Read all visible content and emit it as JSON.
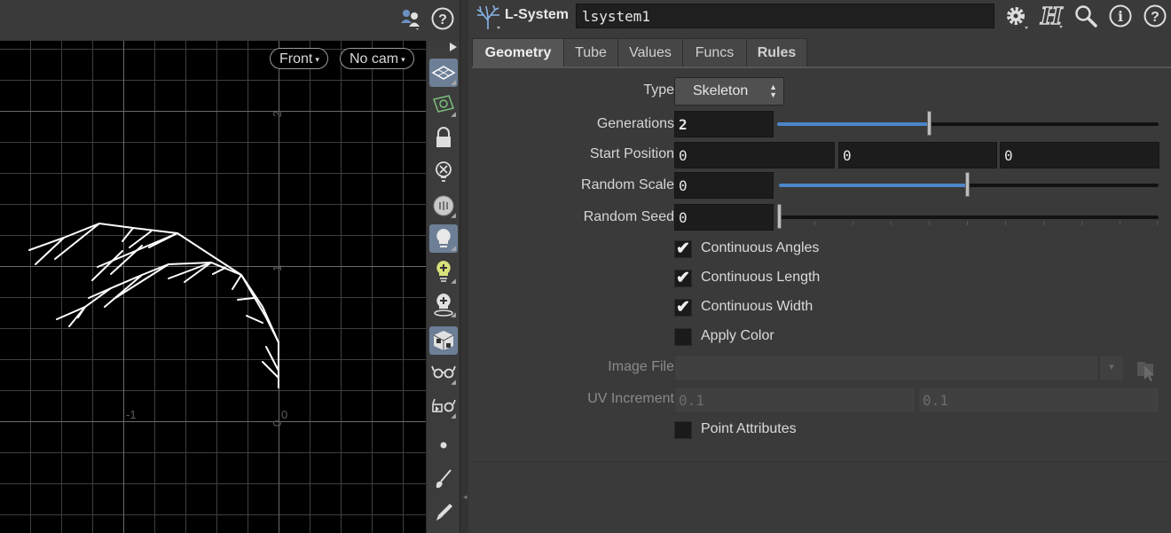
{
  "viewport": {
    "camera_view": "Front",
    "camera_select": "No cam",
    "axis_labels": {
      "y2": "2",
      "y1": "1",
      "y0": "0",
      "xm1": "-1",
      "x0": "0"
    }
  },
  "node": {
    "type_label": "L-System",
    "name": "lsystem1"
  },
  "tabs": [
    {
      "label": "Geometry"
    },
    {
      "label": "Tube"
    },
    {
      "label": "Values"
    },
    {
      "label": "Funcs"
    },
    {
      "label": "Rules"
    }
  ],
  "params": {
    "type": {
      "label": "Type",
      "value": "Skeleton"
    },
    "generations": {
      "label": "Generations",
      "value": "2",
      "slider": 0.4
    },
    "start_position": {
      "label": "Start Position",
      "x": "0",
      "y": "0",
      "z": "0"
    },
    "random_scale": {
      "label": "Random Scale",
      "value": "0",
      "slider": 0.5
    },
    "random_seed": {
      "label": "Random Seed",
      "value": "0",
      "slider": 0.0
    },
    "continuous_angles": {
      "label": "Continuous Angles",
      "checked": true
    },
    "continuous_length": {
      "label": "Continuous Length",
      "checked": true
    },
    "continuous_width": {
      "label": "Continuous Width",
      "checked": true
    },
    "apply_color": {
      "label": "Apply Color",
      "checked": false
    },
    "image_file": {
      "label": "Image File",
      "value": ""
    },
    "uv_increment": {
      "label": "UV Increment",
      "u": "0.1",
      "v": "0.1"
    },
    "point_attributes": {
      "label": "Point Attributes",
      "checked": false
    }
  },
  "checkmark": "✔"
}
